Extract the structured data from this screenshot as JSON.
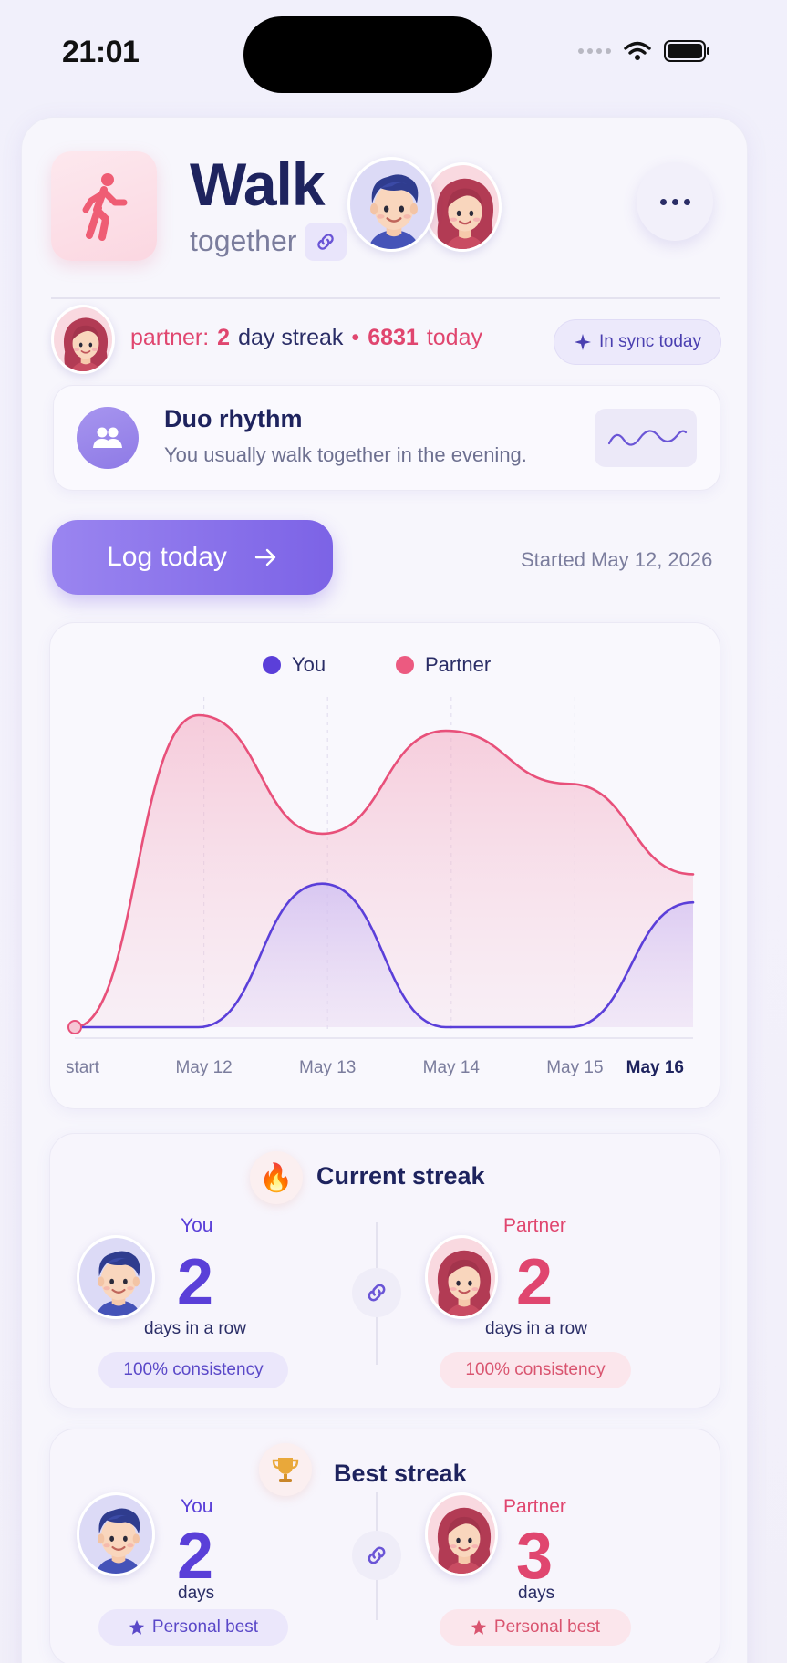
{
  "status_bar": {
    "time": "21:01"
  },
  "header": {
    "title": "Walk",
    "subtitle": "together",
    "icons": [
      "walking-person-icon",
      "link-icon",
      "more-horizontal-icon"
    ]
  },
  "partner_row": {
    "label": "partner:",
    "streak_count": "2",
    "streak_text": "day streak",
    "separator": "•",
    "steps": "6831",
    "steps_text": "today",
    "sync_chip": "In sync today"
  },
  "duo_rhythm": {
    "title": "Duo rhythm",
    "text": "You usually walk together in the evening."
  },
  "log": {
    "button_label": "Log today",
    "started": "Started May 12, 2026"
  },
  "chart_data": {
    "type": "area",
    "legend": [
      "You",
      "Partner"
    ],
    "categories": [
      "start",
      "May 12",
      "May 13",
      "May 14",
      "May 15",
      "May 16"
    ],
    "series": [
      {
        "name": "You",
        "values": [
          0,
          0,
          46,
          0,
          0,
          40
        ]
      },
      {
        "name": "Partner",
        "values": [
          0,
          100,
          62,
          95,
          78,
          49
        ]
      }
    ],
    "ylim": [
      0,
      100
    ],
    "grid": "vertical dashed",
    "highlighted_category": "May 16",
    "colors": {
      "You": "#5b3fd9",
      "Partner": "#e8507a"
    }
  },
  "current_streak": {
    "title": "Current streak",
    "icon": "fire-icon",
    "you": {
      "label": "You",
      "value": "2",
      "unit": "days in a row",
      "pill": "100% consistency"
    },
    "partner": {
      "label": "Partner",
      "value": "2",
      "unit": "days in a row",
      "pill": "100% consistency"
    }
  },
  "best_streak": {
    "title": "Best streak",
    "icon": "trophy-icon",
    "you": {
      "label": "You",
      "value": "2",
      "unit": "days",
      "pill": "Personal best"
    },
    "partner": {
      "label": "Partner",
      "value": "3",
      "unit": "days",
      "pill": "Personal best"
    }
  }
}
